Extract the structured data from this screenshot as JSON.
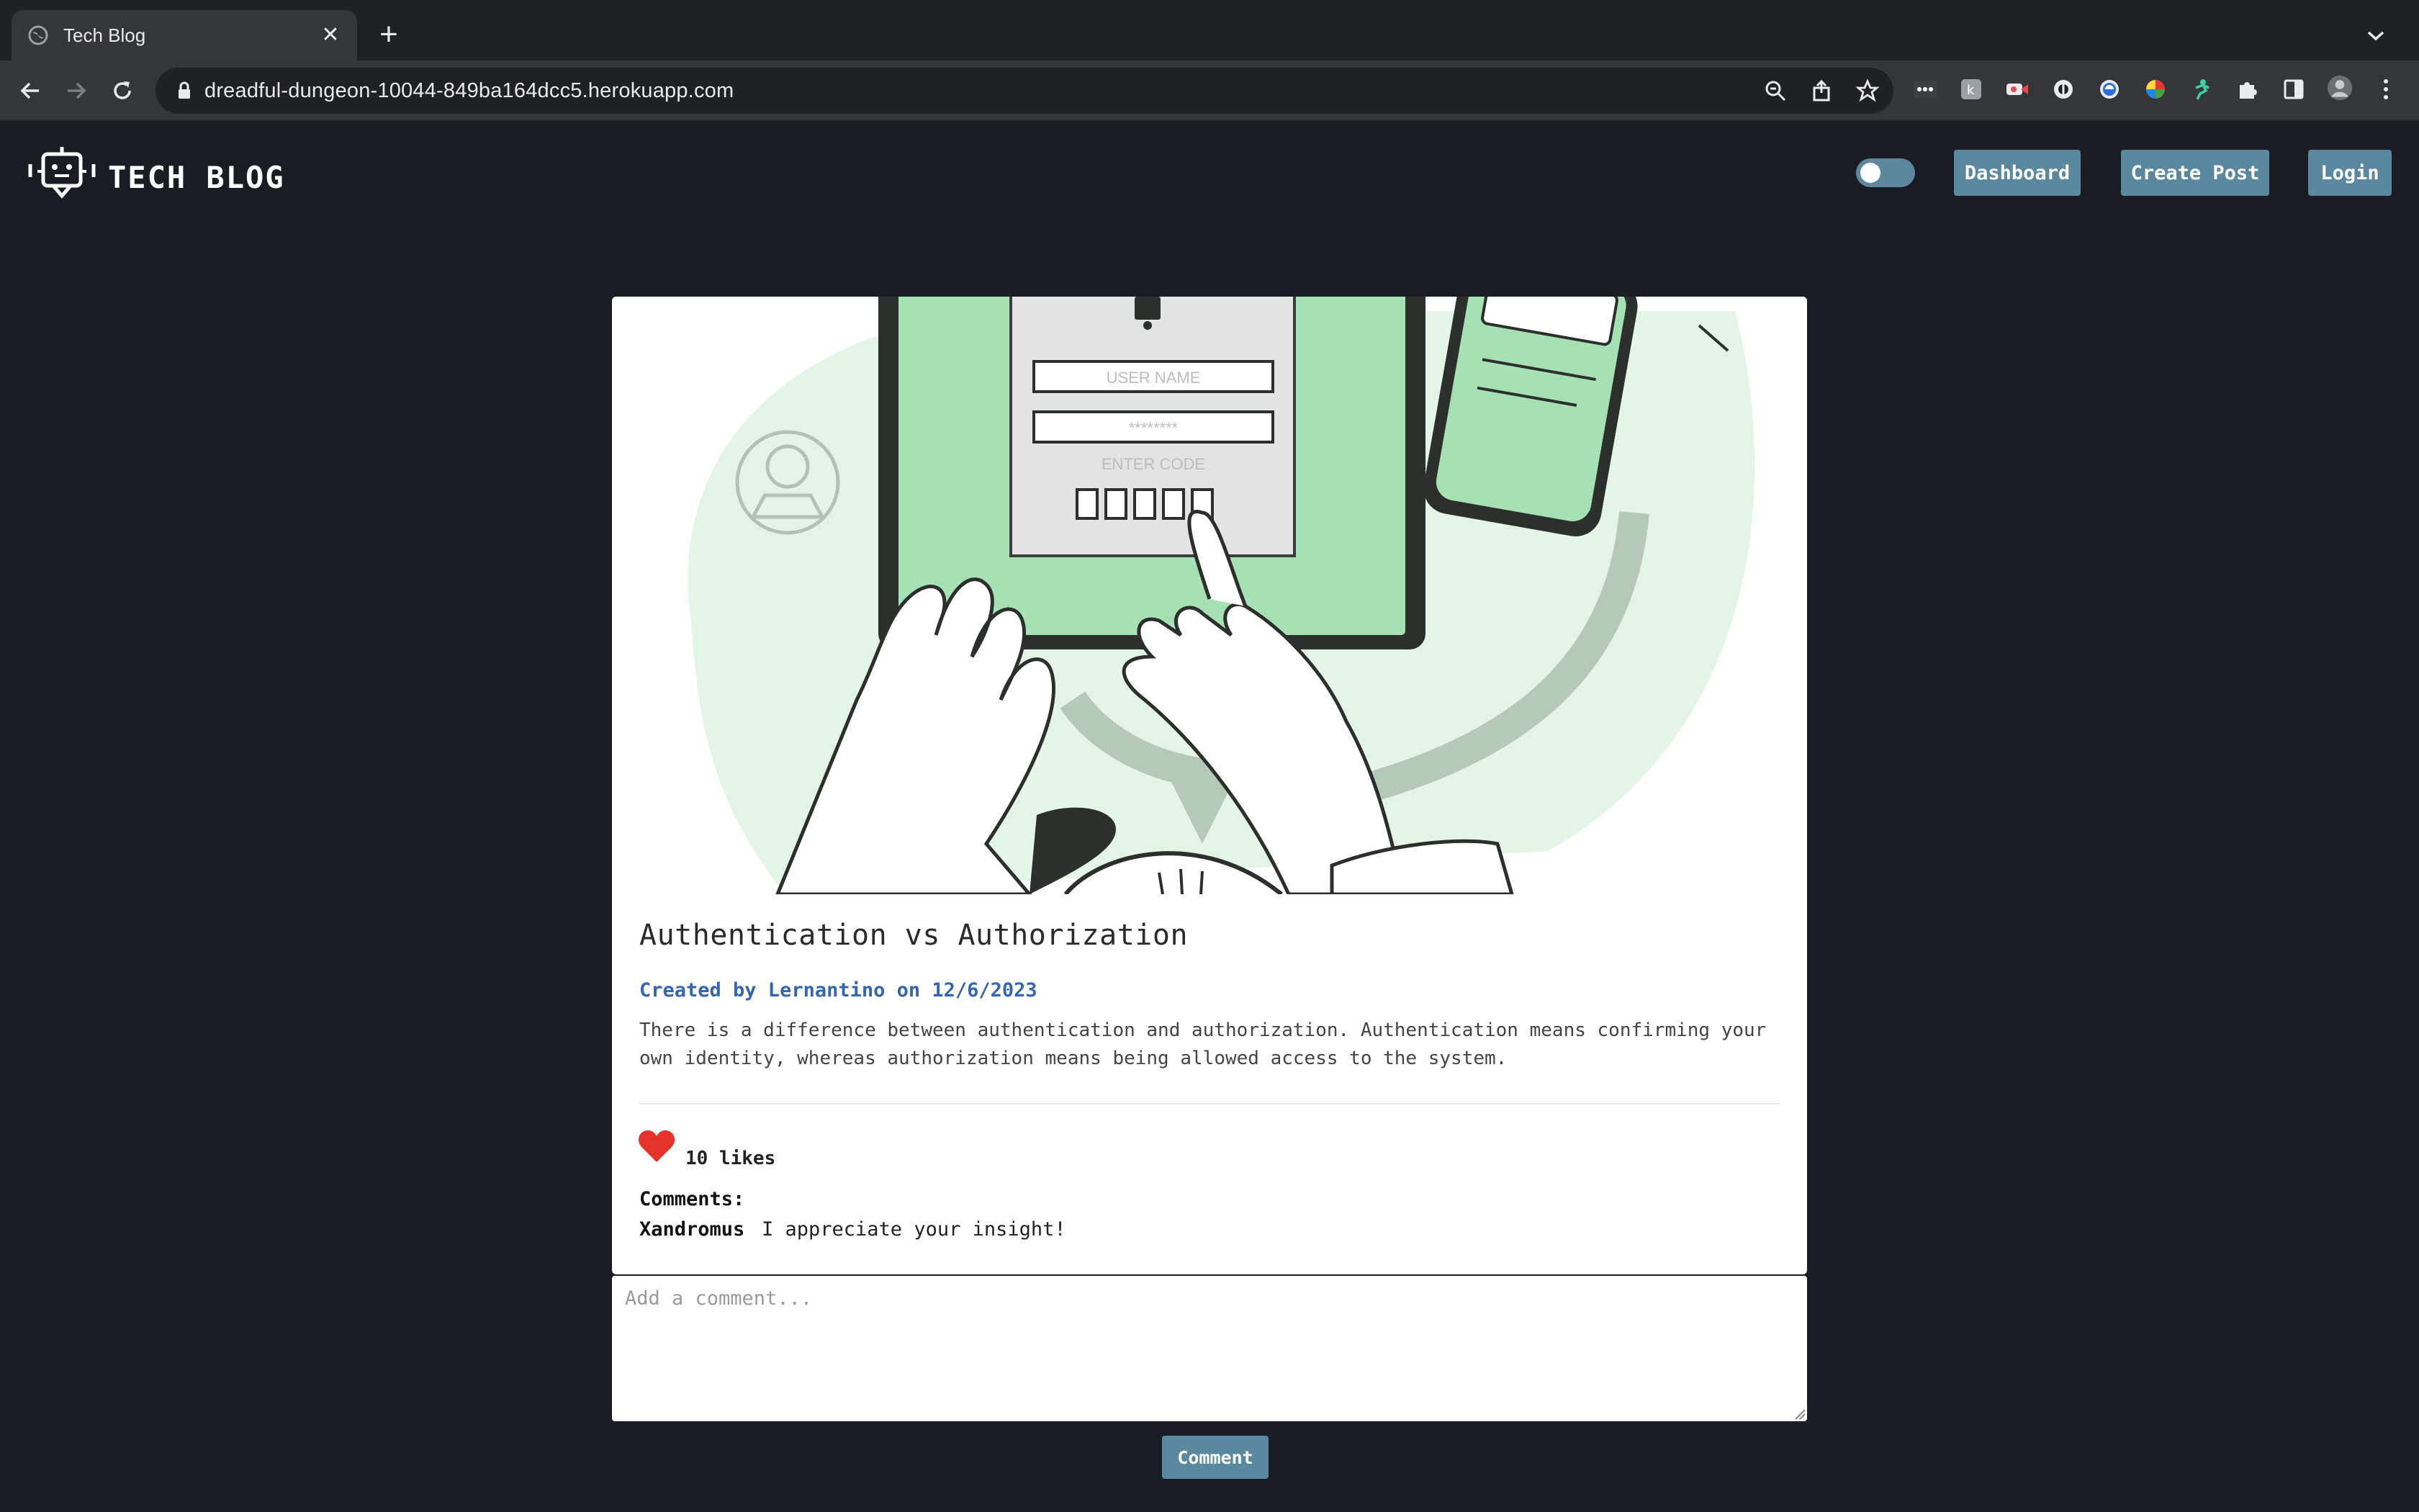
{
  "browser": {
    "tab_title": "Tech Blog",
    "url": "dreadful-dungeon-10044-849ba164dcc5.herokuapp.com"
  },
  "header": {
    "brand": "TECH BLOG",
    "nav": {
      "dashboard": "Dashboard",
      "create_post": "Create Post",
      "login": "Login"
    },
    "theme_toggle_on": false
  },
  "post": {
    "title": "Authentication vs Authorization",
    "meta": "Created by Lernantino on 12/6/2023",
    "body": "There is a difference between authentication and authorization. Authentication means confirming your own identity, whereas authorization means being allowed access to the system.",
    "likes": "10 likes",
    "hero": {
      "username_field": "USER NAME",
      "password_field": "********",
      "code_label": "ENTER CODE"
    }
  },
  "comments": {
    "label": "Comments:",
    "items": [
      {
        "author": "Xandromus",
        "text": "I appreciate your insight!"
      }
    ],
    "input_placeholder": "Add a comment...",
    "submit_label": "Comment"
  },
  "colors": {
    "page_bg": "#1a1c24",
    "button_bg": "#5a889e",
    "meta_link": "#3567b1",
    "like_heart": "#e5322b",
    "hero_green": "#a6e1b4"
  }
}
